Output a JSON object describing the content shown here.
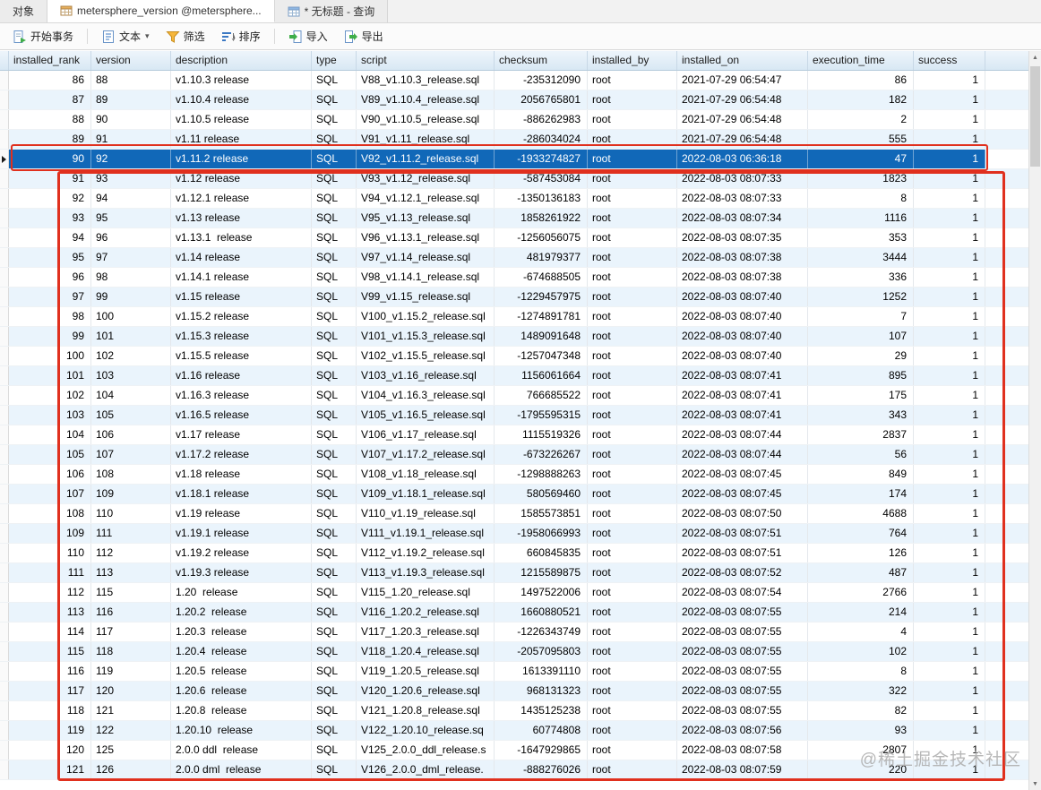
{
  "tabs": [
    {
      "label": "对象"
    },
    {
      "label": "metersphere_version @metersphere...",
      "active": true
    },
    {
      "label": "* 无标题 - 查询"
    }
  ],
  "toolbar": {
    "begin_transaction": "开始事务",
    "text": "文本",
    "filter": "筛选",
    "sort": "排序",
    "import": "导入",
    "export": "导出"
  },
  "grid": {
    "columns": [
      "installed_rank",
      "version",
      "description",
      "type",
      "script",
      "checksum",
      "installed_by",
      "installed_on",
      "execution_time",
      "success"
    ],
    "selected_index": 4,
    "rows": [
      [
        "86",
        "88",
        "v1.10.3 release",
        "SQL",
        "V88_v1.10.3_release.sql",
        "-235312090",
        "root",
        "2021-07-29 06:54:47",
        "86",
        "1"
      ],
      [
        "87",
        "89",
        "v1.10.4 release",
        "SQL",
        "V89_v1.10.4_release.sql",
        "2056765801",
        "root",
        "2021-07-29 06:54:48",
        "182",
        "1"
      ],
      [
        "88",
        "90",
        "v1.10.5 release",
        "SQL",
        "V90_v1.10.5_release.sql",
        "-886262983",
        "root",
        "2021-07-29 06:54:48",
        "2",
        "1"
      ],
      [
        "89",
        "91",
        "v1.11 release",
        "SQL",
        "V91_v1.11_release.sql",
        "-286034024",
        "root",
        "2021-07-29 06:54:48",
        "555",
        "1"
      ],
      [
        "90",
        "92",
        "v1.11.2 release",
        "SQL",
        "V92_v1.11.2_release.sql",
        "-1933274827",
        "root",
        "2022-08-03 06:36:18",
        "47",
        "1"
      ],
      [
        "91",
        "93",
        "v1.12 release",
        "SQL",
        "V93_v1.12_release.sql",
        "-587453084",
        "root",
        "2022-08-03 08:07:33",
        "1823",
        "1"
      ],
      [
        "92",
        "94",
        "v1.12.1 release",
        "SQL",
        "V94_v1.12.1_release.sql",
        "-1350136183",
        "root",
        "2022-08-03 08:07:33",
        "8",
        "1"
      ],
      [
        "93",
        "95",
        "v1.13 release",
        "SQL",
        "V95_v1.13_release.sql",
        "1858261922",
        "root",
        "2022-08-03 08:07:34",
        "1116",
        "1"
      ],
      [
        "94",
        "96",
        "v1.13.1  release",
        "SQL",
        "V96_v1.13.1_release.sql",
        "-1256056075",
        "root",
        "2022-08-03 08:07:35",
        "353",
        "1"
      ],
      [
        "95",
        "97",
        "v1.14 release",
        "SQL",
        "V97_v1.14_release.sql",
        "481979377",
        "root",
        "2022-08-03 08:07:38",
        "3444",
        "1"
      ],
      [
        "96",
        "98",
        "v1.14.1 release",
        "SQL",
        "V98_v1.14.1_release.sql",
        "-674688505",
        "root",
        "2022-08-03 08:07:38",
        "336",
        "1"
      ],
      [
        "97",
        "99",
        "v1.15 release",
        "SQL",
        "V99_v1.15_release.sql",
        "-1229457975",
        "root",
        "2022-08-03 08:07:40",
        "1252",
        "1"
      ],
      [
        "98",
        "100",
        "v1.15.2 release",
        "SQL",
        "V100_v1.15.2_release.sql",
        "-1274891781",
        "root",
        "2022-08-03 08:07:40",
        "7",
        "1"
      ],
      [
        "99",
        "101",
        "v1.15.3 release",
        "SQL",
        "V101_v1.15.3_release.sql",
        "1489091648",
        "root",
        "2022-08-03 08:07:40",
        "107",
        "1"
      ],
      [
        "100",
        "102",
        "v1.15.5 release",
        "SQL",
        "V102_v1.15.5_release.sql",
        "-1257047348",
        "root",
        "2022-08-03 08:07:40",
        "29",
        "1"
      ],
      [
        "101",
        "103",
        "v1.16 release",
        "SQL",
        "V103_v1.16_release.sql",
        "1156061664",
        "root",
        "2022-08-03 08:07:41",
        "895",
        "1"
      ],
      [
        "102",
        "104",
        "v1.16.3 release",
        "SQL",
        "V104_v1.16.3_release.sql",
        "766685522",
        "root",
        "2022-08-03 08:07:41",
        "175",
        "1"
      ],
      [
        "103",
        "105",
        "v1.16.5 release",
        "SQL",
        "V105_v1.16.5_release.sql",
        "-1795595315",
        "root",
        "2022-08-03 08:07:41",
        "343",
        "1"
      ],
      [
        "104",
        "106",
        "v1.17 release",
        "SQL",
        "V106_v1.17_release.sql",
        "1115519326",
        "root",
        "2022-08-03 08:07:44",
        "2837",
        "1"
      ],
      [
        "105",
        "107",
        "v1.17.2 release",
        "SQL",
        "V107_v1.17.2_release.sql",
        "-673226267",
        "root",
        "2022-08-03 08:07:44",
        "56",
        "1"
      ],
      [
        "106",
        "108",
        "v1.18 release",
        "SQL",
        "V108_v1.18_release.sql",
        "-1298888263",
        "root",
        "2022-08-03 08:07:45",
        "849",
        "1"
      ],
      [
        "107",
        "109",
        "v1.18.1 release",
        "SQL",
        "V109_v1.18.1_release.sql",
        "580569460",
        "root",
        "2022-08-03 08:07:45",
        "174",
        "1"
      ],
      [
        "108",
        "110",
        "v1.19 release",
        "SQL",
        "V110_v1.19_release.sql",
        "1585573851",
        "root",
        "2022-08-03 08:07:50",
        "4688",
        "1"
      ],
      [
        "109",
        "111",
        "v1.19.1 release",
        "SQL",
        "V111_v1.19.1_release.sql",
        "-1958066993",
        "root",
        "2022-08-03 08:07:51",
        "764",
        "1"
      ],
      [
        "110",
        "112",
        "v1.19.2 release",
        "SQL",
        "V112_v1.19.2_release.sql",
        "660845835",
        "root",
        "2022-08-03 08:07:51",
        "126",
        "1"
      ],
      [
        "111",
        "113",
        "v1.19.3 release",
        "SQL",
        "V113_v1.19.3_release.sql",
        "1215589875",
        "root",
        "2022-08-03 08:07:52",
        "487",
        "1"
      ],
      [
        "112",
        "115",
        "1.20  release",
        "SQL",
        "V115_1.20_release.sql",
        "1497522006",
        "root",
        "2022-08-03 08:07:54",
        "2766",
        "1"
      ],
      [
        "113",
        "116",
        "1.20.2  release",
        "SQL",
        "V116_1.20.2_release.sql",
        "1660880521",
        "root",
        "2022-08-03 08:07:55",
        "214",
        "1"
      ],
      [
        "114",
        "117",
        "1.20.3  release",
        "SQL",
        "V117_1.20.3_release.sql",
        "-1226343749",
        "root",
        "2022-08-03 08:07:55",
        "4",
        "1"
      ],
      [
        "115",
        "118",
        "1.20.4  release",
        "SQL",
        "V118_1.20.4_release.sql",
        "-2057095803",
        "root",
        "2022-08-03 08:07:55",
        "102",
        "1"
      ],
      [
        "116",
        "119",
        "1.20.5  release",
        "SQL",
        "V119_1.20.5_release.sql",
        "1613391110",
        "root",
        "2022-08-03 08:07:55",
        "8",
        "1"
      ],
      [
        "117",
        "120",
        "1.20.6  release",
        "SQL",
        "V120_1.20.6_release.sql",
        "968131323",
        "root",
        "2022-08-03 08:07:55",
        "322",
        "1"
      ],
      [
        "118",
        "121",
        "1.20.8  release",
        "SQL",
        "V121_1.20.8_release.sql",
        "1435125238",
        "root",
        "2022-08-03 08:07:55",
        "82",
        "1"
      ],
      [
        "119",
        "122",
        "1.20.10  release",
        "SQL",
        "V122_1.20.10_release.sq",
        "60774808",
        "root",
        "2022-08-03 08:07:56",
        "93",
        "1"
      ],
      [
        "120",
        "125",
        "2.0.0 ddl  release",
        "SQL",
        "V125_2.0.0_ddl_release.s",
        "-1647929865",
        "root",
        "2022-08-03 08:07:58",
        "2807",
        "1"
      ],
      [
        "121",
        "126",
        "2.0.0 dml  release",
        "SQL",
        "V126_2.0.0_dml_release.",
        "-888276026",
        "root",
        "2022-08-03 08:07:59",
        "220",
        "1"
      ]
    ]
  },
  "watermark": "@稀土掘金技术社区",
  "colors": {
    "selection": "#1168b8",
    "annotation_red": "#e0301e",
    "header_bg": "#d8e8f4",
    "alt_row": "#eaf4fc"
  }
}
